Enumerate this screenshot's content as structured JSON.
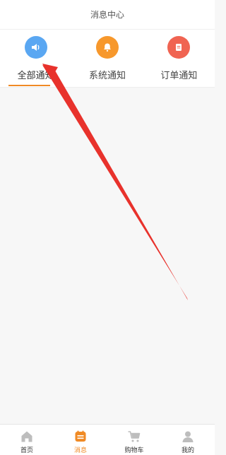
{
  "header": {
    "title": "消息中心"
  },
  "tabs": [
    {
      "label": "全部通知",
      "icon": "speaker-icon",
      "color": "#5aa7f2",
      "active": true
    },
    {
      "label": "系统通知",
      "icon": "bell-icon",
      "color": "#f7982c",
      "active": false
    },
    {
      "label": "订单通知",
      "icon": "document-icon",
      "color": "#f06452",
      "active": false
    }
  ],
  "tabbar": [
    {
      "label": "首页",
      "icon": "home-icon",
      "active": false
    },
    {
      "label": "消息",
      "icon": "message-icon",
      "active": true
    },
    {
      "label": "购物车",
      "icon": "cart-icon",
      "active": false
    },
    {
      "label": "我的",
      "icon": "user-icon",
      "active": false
    }
  ],
  "colors": {
    "accent": "#f08a24",
    "annotation_arrow": "#e8322c"
  }
}
